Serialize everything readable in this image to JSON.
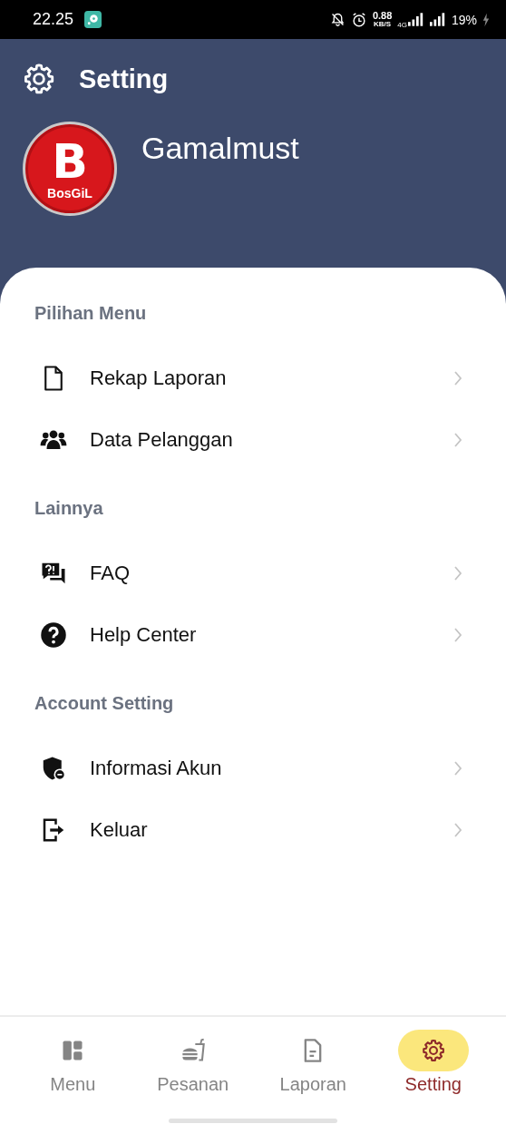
{
  "status_bar": {
    "time": "22.25",
    "speed": "0.88",
    "speed_unit": "KB/S",
    "network": "4G",
    "battery": "19%"
  },
  "header": {
    "title": "Setting",
    "avatar": {
      "letter": "B",
      "brand": "BosGiL"
    },
    "user_name": "Gamalmust"
  },
  "sections": [
    {
      "title": "Pilihan Menu",
      "items": [
        {
          "label": "Rekap Laporan"
        },
        {
          "label": "Data Pelanggan"
        }
      ]
    },
    {
      "title": "Lainnya",
      "items": [
        {
          "label": "FAQ"
        },
        {
          "label": "Help Center"
        }
      ]
    },
    {
      "title": "Account Setting",
      "items": [
        {
          "label": "Informasi Akun"
        },
        {
          "label": "Keluar"
        }
      ]
    }
  ],
  "bottom_nav": [
    {
      "label": "Menu",
      "selected": false
    },
    {
      "label": "Pesanan",
      "selected": false
    },
    {
      "label": "Laporan",
      "selected": false
    },
    {
      "label": "Setting",
      "selected": true
    }
  ]
}
